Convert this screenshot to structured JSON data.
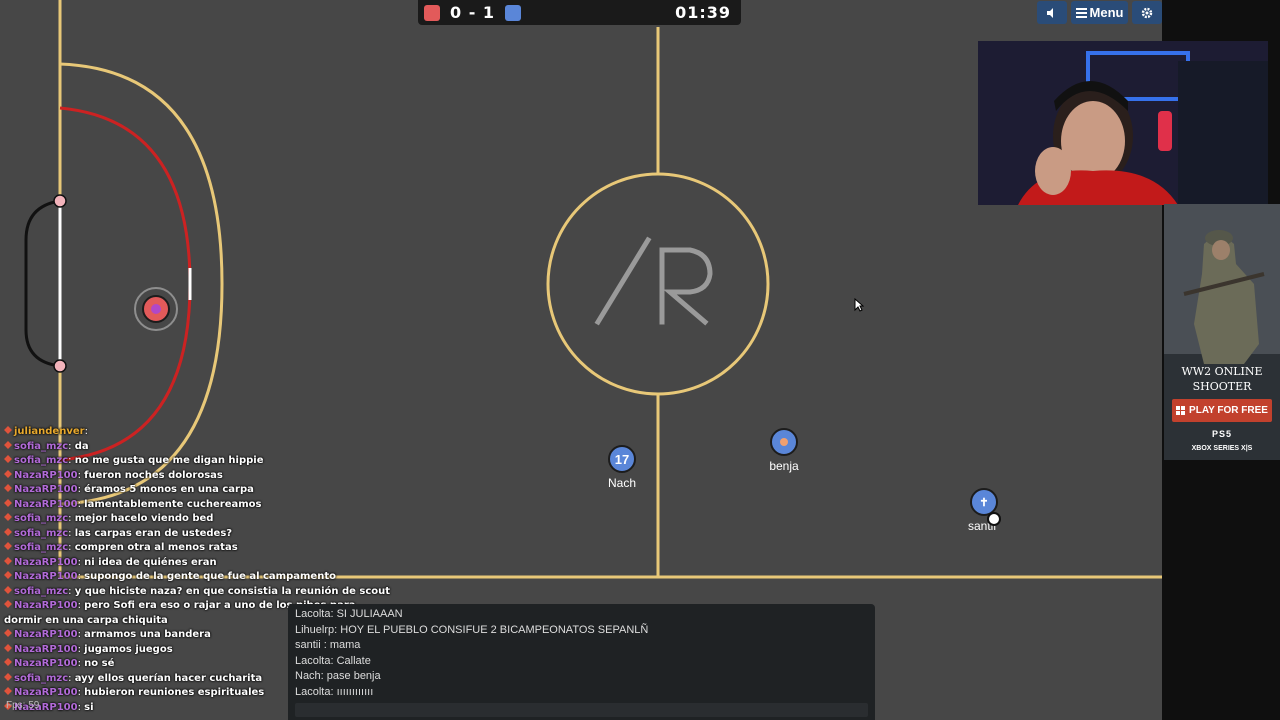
{
  "scoreboard": {
    "score": "0 - 1",
    "timer": "01:39",
    "red_color": "#e25a5a",
    "blue_color": "#5a86d8"
  },
  "top_buttons": {
    "mute_icon": "speaker-icon",
    "menu_label": "Menu",
    "menu_icon": "hamburger-icon",
    "settings_icon": "gear-icon"
  },
  "field": {
    "center_logo": "/R",
    "line_color": "#e8c878",
    "goal_area_color": "#cc2222",
    "background": "#474747"
  },
  "players": [
    {
      "name": "Nach",
      "number": "17",
      "team": "blue"
    },
    {
      "name": "benja",
      "number": "",
      "team": "blue"
    },
    {
      "name": "santii",
      "number": "",
      "team": "blue"
    }
  ],
  "ad": {
    "title": "WW2 ONLINE SHOOTER",
    "cta": "PLAY FOR FREE",
    "platform1": "PS5",
    "platform2": "XBOX SERIES X|S"
  },
  "twitch_chat": [
    {
      "user": "juliandenver",
      "color": "#e8a92e",
      "text": ""
    },
    {
      "user": "sofia_mzc",
      "color": "#b26bd8",
      "text": "da"
    },
    {
      "user": "sofia_mzc",
      "color": "#b26bd8",
      "text": "no me gusta que me digan hippie"
    },
    {
      "user": "NazaRP100",
      "color": "#b26bd8",
      "text": "fueron noches dolorosas"
    },
    {
      "user": "NazaRP100",
      "color": "#b26bd8",
      "text": "éramos 5 monos en una carpa"
    },
    {
      "user": "NazaRP100",
      "color": "#b26bd8",
      "text": "lamentablemente cuchereamos"
    },
    {
      "user": "sofia_mzc",
      "color": "#b26bd8",
      "text": "mejor hacelo viendo bed"
    },
    {
      "user": "sofia_mzc",
      "color": "#b26bd8",
      "text": "las carpas eran de ustedes?"
    },
    {
      "user": "sofia_mzc",
      "color": "#b26bd8",
      "text": "compren otra al menos ratas"
    },
    {
      "user": "NazaRP100",
      "color": "#b26bd8",
      "text": "ni idea de quiénes eran"
    },
    {
      "user": "NazaRP100",
      "color": "#b26bd8",
      "text": "supongo de la gente que fue al campamento"
    },
    {
      "user": "sofia_mzc",
      "color": "#b26bd8",
      "text": "y que hiciste naza? en que consistia la reunión de scout"
    },
    {
      "user": "NazaRP100",
      "color": "#b26bd8",
      "text": "pero Sofi era eso o rajar a uno de los pibes para dormir en una carpa chiquita"
    },
    {
      "user": "NazaRP100",
      "color": "#b26bd8",
      "text": "armamos una bandera"
    },
    {
      "user": "NazaRP100",
      "color": "#b26bd8",
      "text": "jugamos juegos"
    },
    {
      "user": "NazaRP100",
      "color": "#b26bd8",
      "text": "no sé"
    },
    {
      "user": "sofia_mzc",
      "color": "#b26bd8",
      "text": "ayy ellos querían hacer cucharita"
    },
    {
      "user": "NazaRP100",
      "color": "#b26bd8",
      "text": "hubieron reuniones espirituales"
    },
    {
      "user": "NazaRP100",
      "color": "#b26bd8",
      "text": "si"
    }
  ],
  "game_chat": [
    "Lacolta: SI JULIAAAN",
    "Lihuelrp: HOY EL PUEBLO CONSIFUE 2 BICAMPEONATOS SEPANLÑ",
    "santii : mama",
    "Lacolta: Callate",
    "Nach: pase benja",
    "Lacolta: ıııııııııııı"
  ],
  "fps": "Fps: 59"
}
